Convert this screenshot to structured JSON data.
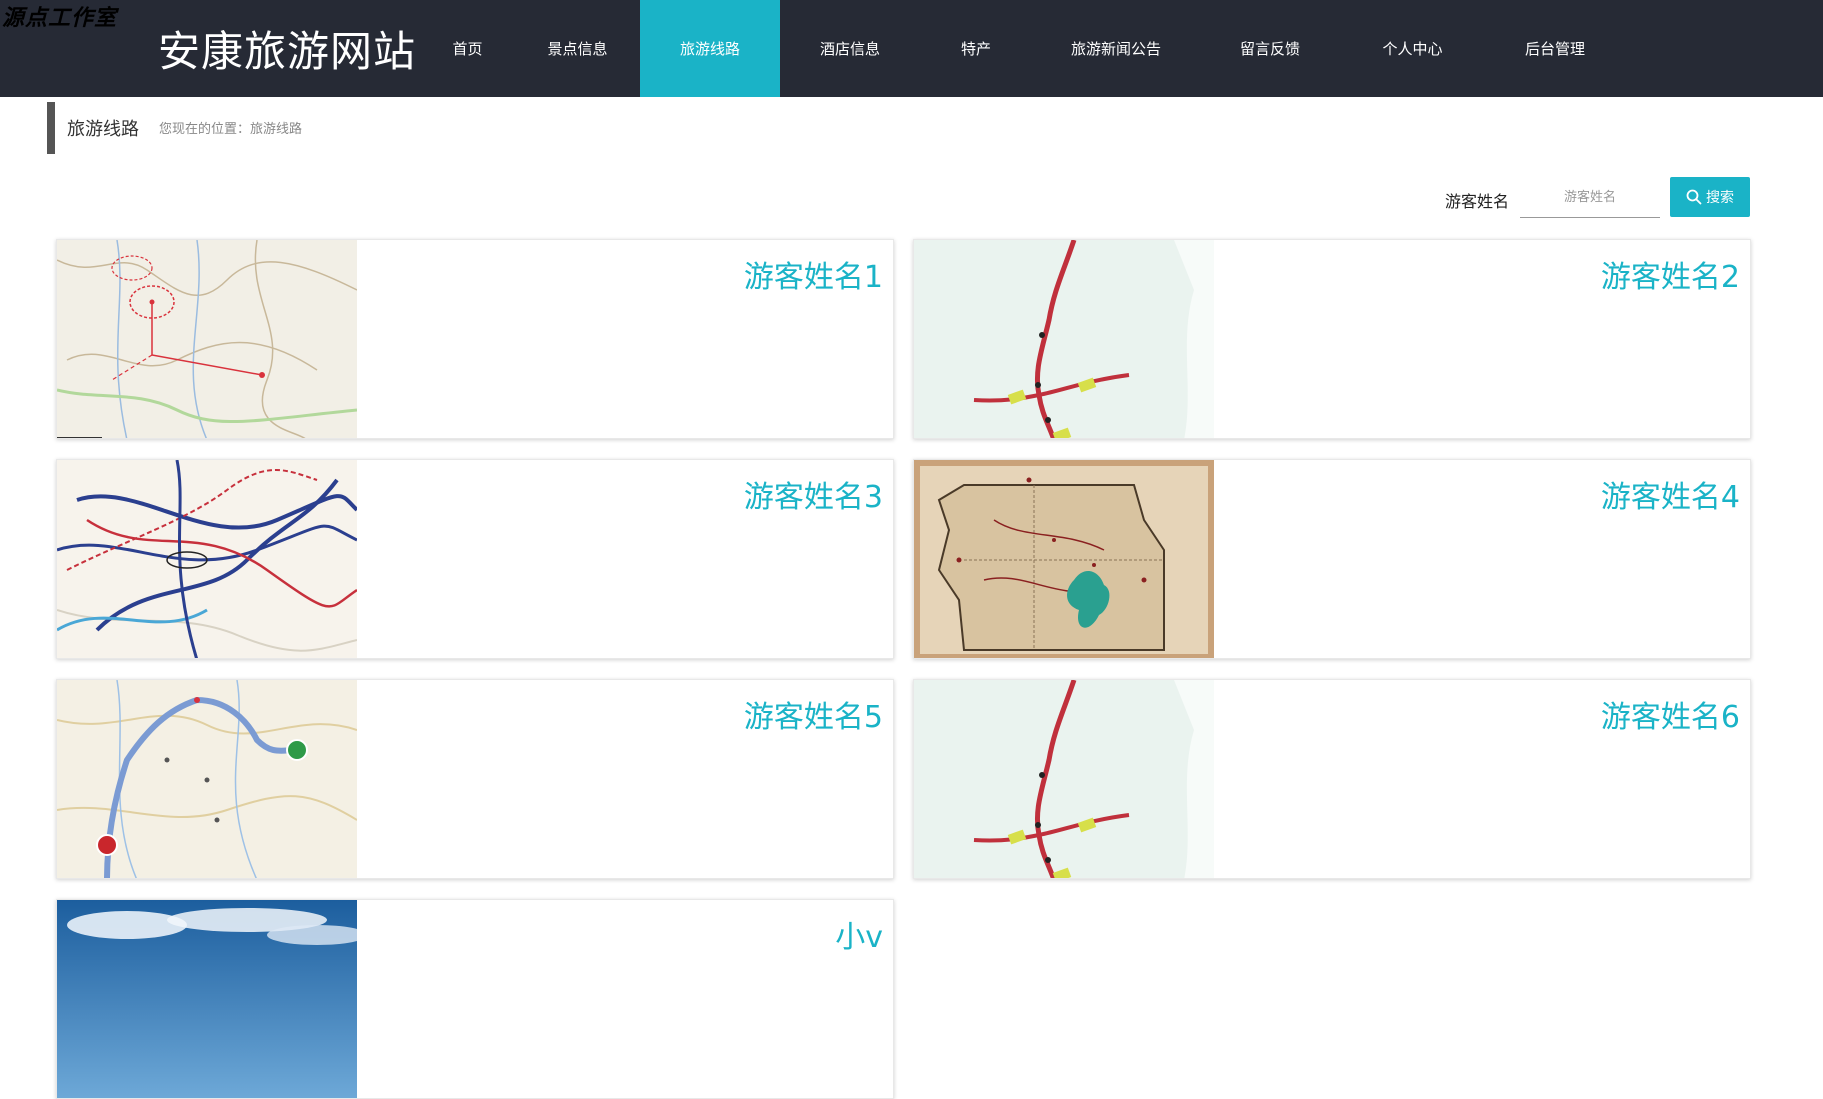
{
  "watermark": "源点工作室",
  "site": {
    "title": "安康旅游网站"
  },
  "nav": {
    "items": [
      {
        "label": "首页"
      },
      {
        "label": "景点信息"
      },
      {
        "label": "旅游线路"
      },
      {
        "label": "酒店信息"
      },
      {
        "label": "特产"
      },
      {
        "label": "旅游新闻公告"
      },
      {
        "label": "留言反馈"
      },
      {
        "label": "个人中心"
      },
      {
        "label": "后台管理"
      }
    ],
    "active_index": 2
  },
  "breadcrumb": {
    "title": "旅游线路",
    "path_prefix": "您现在的位置：",
    "path_current": "旅游线路"
  },
  "search": {
    "label": "游客姓名",
    "placeholder": "游客姓名",
    "value": "",
    "button_label": "搜索"
  },
  "routes": [
    {
      "name": "游客姓名1",
      "thumb": "map-yunnan-route-icon"
    },
    {
      "name": "游客姓名2",
      "thumb": "map-red-highway-icon"
    },
    {
      "name": "游客姓名3",
      "thumb": "map-historic-routes-icon"
    },
    {
      "name": "游客姓名4",
      "thumb": "map-park-vintage-icon"
    },
    {
      "name": "游客姓名5",
      "thumb": "map-sichuan-route-icon"
    },
    {
      "name": "游客姓名6",
      "thumb": "map-red-highway-icon"
    },
    {
      "name": "小v",
      "thumb": "sky-clouds-photo-icon"
    }
  ],
  "colors": {
    "header_bg": "#262a35",
    "accent": "#1ab3c7"
  }
}
